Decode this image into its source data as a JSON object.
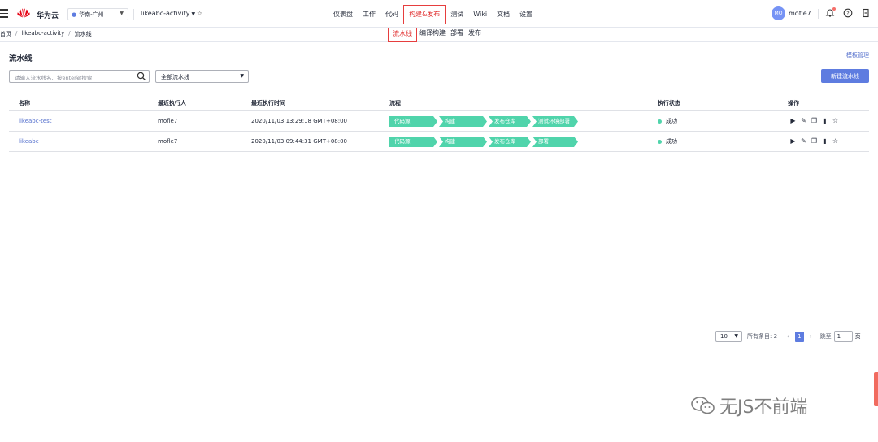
{
  "header": {
    "brand": "华为云",
    "region": "华南-广州",
    "project": "likeabc-activity",
    "nav": [
      {
        "label": "仪表盘",
        "active": false
      },
      {
        "label": "工作",
        "active": false
      },
      {
        "label": "代码",
        "active": false
      },
      {
        "label": "构建&发布",
        "active": true
      },
      {
        "label": "测试",
        "active": false
      },
      {
        "label": "Wiki",
        "active": false
      },
      {
        "label": "文档",
        "active": false
      },
      {
        "label": "设置",
        "active": false
      }
    ],
    "user_initials": "MO",
    "username": "mofle7",
    "icons": [
      "menu-icon",
      "huawei-logo",
      "location-pin-icon",
      "star-icon",
      "bell-icon",
      "help-icon",
      "exit-icon"
    ]
  },
  "breadcrumb": [
    "首页",
    "likeabc-activity",
    "流水线"
  ],
  "subnav": [
    {
      "label": "流水线",
      "active": true
    },
    {
      "label": "编译构建",
      "active": false
    },
    {
      "label": "部署",
      "active": false
    },
    {
      "label": "发布",
      "active": false
    }
  ],
  "page": {
    "title": "流水线",
    "template_link": "模板管理",
    "search_placeholder": "请输入流水线名、按enter键搜索",
    "filter_value": "全部流水线",
    "new_button": "新建流水线"
  },
  "table": {
    "headers": [
      "名称",
      "最近执行人",
      "最近执行时间",
      "流程",
      "执行状态",
      "操作"
    ],
    "rows": [
      {
        "name": "likeabc-test",
        "executor": "mofle7",
        "time": "2020/11/03 13:29:18 GMT+08:00",
        "stages": [
          "代码源",
          "构建",
          "发布仓库",
          "测试环境部署"
        ],
        "status": "成功"
      },
      {
        "name": "likeabc",
        "executor": "mofle7",
        "time": "2020/11/03 09:44:31 GMT+08:00",
        "stages": [
          "代码源",
          "构建",
          "发布仓库",
          "部署"
        ],
        "status": "成功"
      }
    ],
    "op_icons": [
      "run-icon",
      "edit-icon",
      "copy-icon",
      "delete-icon",
      "favorite-icon"
    ]
  },
  "pagination": {
    "page_size": "10",
    "total_label": "所有条目: 2",
    "current_page": "1",
    "jump_label": "跳至",
    "jump_value": "1",
    "page_unit": "页"
  },
  "watermark": "无JS不前端",
  "colors": {
    "accent": "#5e7ce0",
    "highlight": "#e63e3e",
    "stage": "#50d4ab"
  }
}
